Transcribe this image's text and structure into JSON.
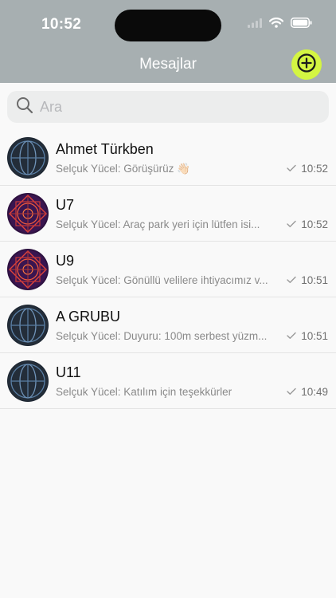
{
  "status_bar": {
    "time": "10:52"
  },
  "header": {
    "title": "Mesajlar",
    "accent_color": "#d4f542",
    "bar_color": "#a7afb1"
  },
  "search": {
    "placeholder": "Ara",
    "value": ""
  },
  "conversations": [
    {
      "name": "Ahmet Türkben",
      "preview": "Selçuk Yücel: Görüşürüz 👋🏻",
      "time": "10:52",
      "avatar": "dark-blue-emblem"
    },
    {
      "name": "U7",
      "preview": "Selçuk Yücel: Araç park yeri için lütfen isi...",
      "time": "10:52",
      "avatar": "purple-red-emblem"
    },
    {
      "name": "U9",
      "preview": "Selçuk Yücel: Gönüllü velilere ihtiyacımız v...",
      "time": "10:51",
      "avatar": "purple-red-emblem"
    },
    {
      "name": "A GRUBU",
      "preview": "Selçuk Yücel: Duyuru: 100m serbest yüzm...",
      "time": "10:51",
      "avatar": "dark-blue-emblem"
    },
    {
      "name": "U11",
      "preview": "Selçuk Yücel: Katılım için teşekkürler",
      "time": "10:49",
      "avatar": "dark-blue-emblem"
    }
  ]
}
